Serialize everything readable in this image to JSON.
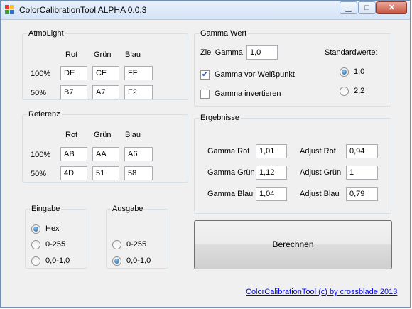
{
  "window": {
    "title": "ColorCalibrationTool ALPHA 0.0.3"
  },
  "titlebar_buttons": {
    "minimize": "▁",
    "maximize": "□",
    "close": "✕"
  },
  "atmolight": {
    "legend": "AtmoLight",
    "col_rot": "Rot",
    "col_gruen": "Grün",
    "col_blau": "Blau",
    "rows": [
      {
        "label": "100%",
        "rot": "DE",
        "gruen": "CF",
        "blau": "FF"
      },
      {
        "label": "50%",
        "rot": "B7",
        "gruen": "A7",
        "blau": "F2"
      }
    ]
  },
  "referenz": {
    "legend": "Referenz",
    "col_rot": "Rot",
    "col_gruen": "Grün",
    "col_blau": "Blau",
    "rows": [
      {
        "label": "100%",
        "rot": "AB",
        "gruen": "AA",
        "blau": "A6"
      },
      {
        "label": "50%",
        "rot": "4D",
        "gruen": "51",
        "blau": "58"
      }
    ]
  },
  "eingabe": {
    "legend": "Eingabe",
    "options": [
      "Hex",
      "0-255",
      "0,0-1,0"
    ],
    "selected": "Hex"
  },
  "ausgabe": {
    "legend": "Ausgabe",
    "options": [
      "0-255",
      "0,0-1,0"
    ],
    "selected": "0,0-1,0"
  },
  "gamma_wert": {
    "legend": "Gamma Wert",
    "ziel_label": "Ziel Gamma",
    "ziel_value": "1,0",
    "standardwerte_label": "Standardwerte:",
    "standard_options": [
      "1,0",
      "2,2"
    ],
    "standard_selected": "1,0",
    "gamma_vor_weisspunkt": {
      "label": "Gamma vor Weißpunkt",
      "checked": true
    },
    "gamma_invertieren": {
      "label": "Gamma invertieren",
      "checked": false
    }
  },
  "ergebnisse": {
    "legend": "Ergebnisse",
    "gamma_rot_label": "Gamma Rot",
    "gamma_rot": "1,01",
    "gamma_gruen_label": "Gamma Grün",
    "gamma_gruen": "1,12",
    "gamma_blau_label": "Gamma Blau",
    "gamma_blau": "1,04",
    "adjust_rot_label": "Adjust Rot",
    "adjust_rot": "0,94",
    "adjust_gruen_label": "Adjust Grün",
    "adjust_gruen": "1",
    "adjust_blau_label": "Adjust Blau",
    "adjust_blau": "0,79"
  },
  "berechnen_label": "Berechnen",
  "footer_link": "ColorCalibrationTool (c) by crossblade 2013",
  "colors": {
    "titlebar": "#d3e3f6",
    "window_bg": "#f0f0f0",
    "link": "#0000ee",
    "radio_dot": "#1a5ea8"
  }
}
